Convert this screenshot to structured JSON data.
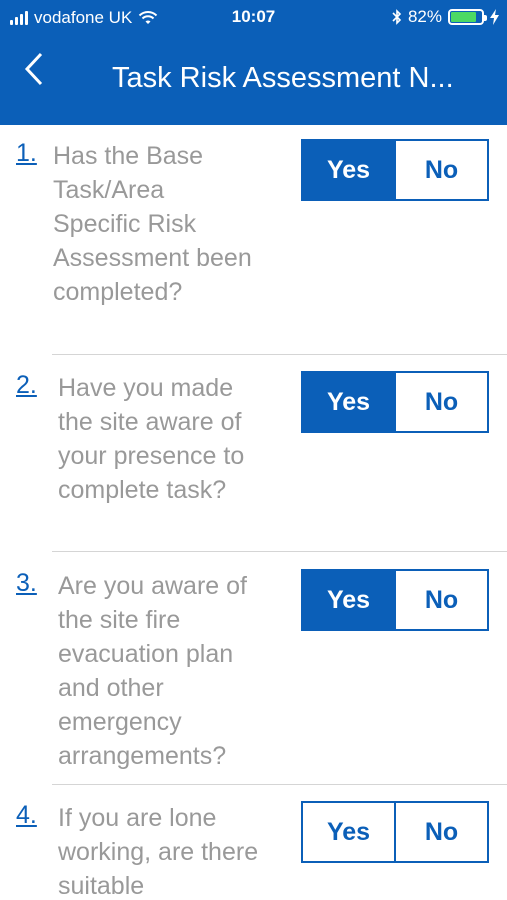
{
  "status_bar": {
    "carrier": "vodafone UK",
    "time": "10:07",
    "battery_percent": "82%",
    "battery_level": 0.82
  },
  "nav": {
    "title": "Task Risk Assessment N..."
  },
  "questions": [
    {
      "number": "1.",
      "text": "Has the Base Task/Area Specific Risk Assessment been completed?",
      "yes_label": "Yes",
      "no_label": "No",
      "selected": "yes"
    },
    {
      "number": "2.",
      "text": "Have you made the site aware of your presence to complete task?",
      "yes_label": "Yes",
      "no_label": "No",
      "selected": "yes"
    },
    {
      "number": "3.",
      "text": "Are you aware of the site fire evacuation plan and other emergency arrangements?",
      "yes_label": "Yes",
      "no_label": "No",
      "selected": "yes"
    },
    {
      "number": "4.",
      "text": "If you are lone working, are there suitable",
      "yes_label": "Yes",
      "no_label": "No",
      "selected": "none"
    }
  ],
  "colors": {
    "accent": "#0b5fb8",
    "question_text": "#999999",
    "battery": "#4cd964"
  }
}
